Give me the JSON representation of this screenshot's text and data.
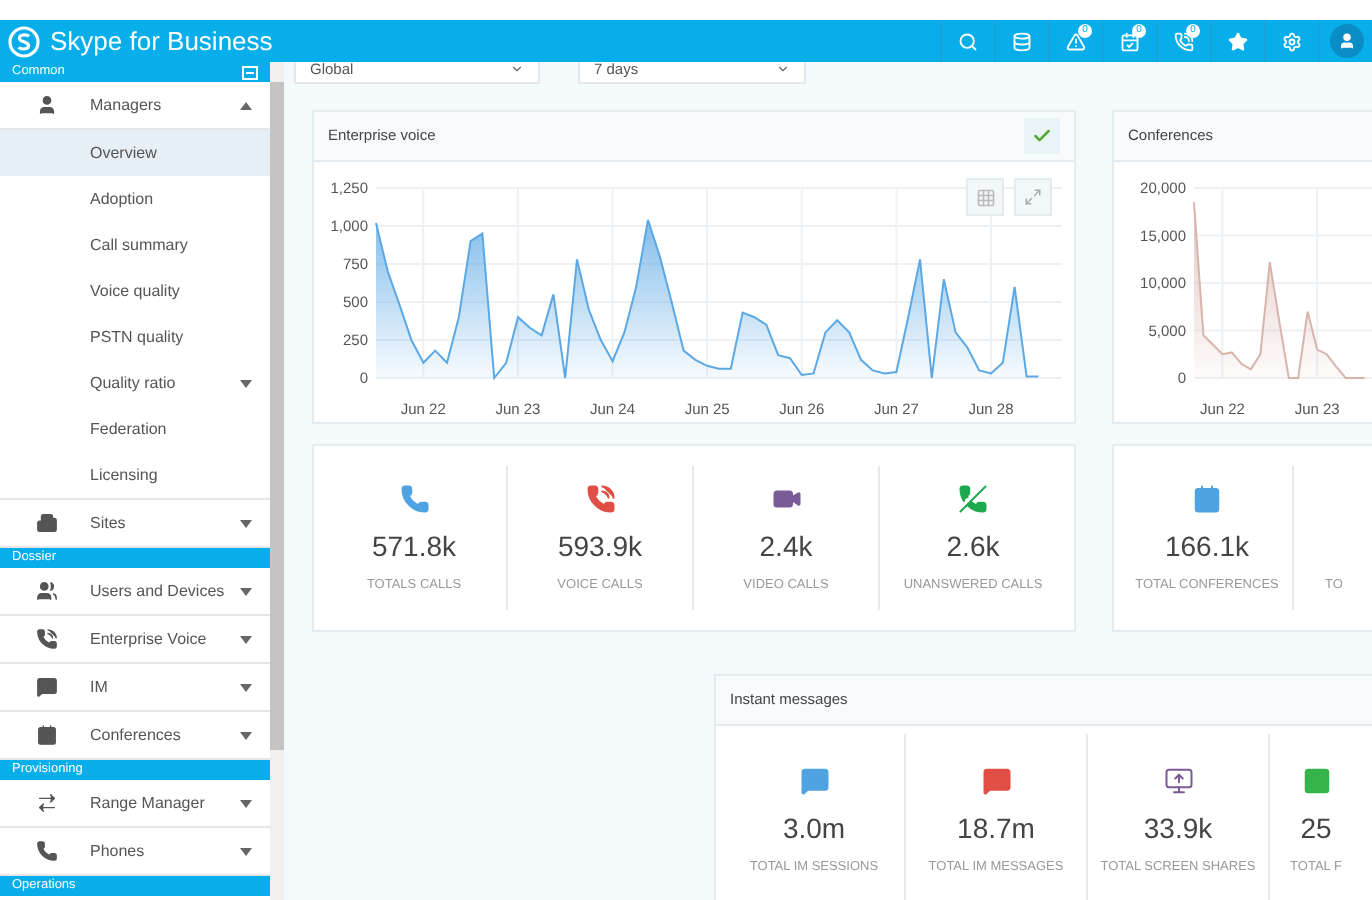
{
  "app": {
    "title": "Skype for Business"
  },
  "toolbar": {
    "badges": [
      "0",
      "0",
      "0"
    ]
  },
  "filters": [
    {
      "value": "Global"
    },
    {
      "value": "7 days"
    }
  ],
  "sidebar": {
    "sections": [
      {
        "title": "Common",
        "items": [
          {
            "label": "Managers",
            "selected": false,
            "expanded": true,
            "children": [
              {
                "label": "Overview",
                "selected": true
              },
              {
                "label": "Adoption",
                "selected": false
              },
              {
                "label": "Call summary",
                "selected": false
              },
              {
                "label": "Voice quality",
                "selected": false
              },
              {
                "label": "PSTN quality",
                "selected": false
              },
              {
                "label": "Quality ratio",
                "selected": false,
                "expanded": false
              },
              {
                "label": "Federation",
                "selected": false
              },
              {
                "label": "Licensing",
                "selected": false
              }
            ]
          },
          {
            "label": "Sites",
            "selected": false,
            "expanded": false
          }
        ]
      },
      {
        "title": "Dossier",
        "items": [
          {
            "label": "Users and Devices",
            "selected": false,
            "expanded": false
          },
          {
            "label": "Enterprise Voice",
            "selected": false,
            "expanded": false
          },
          {
            "label": "IM",
            "selected": false,
            "expanded": false
          },
          {
            "label": "Conferences",
            "selected": false,
            "expanded": false
          }
        ]
      },
      {
        "title": "Provisioning",
        "items": [
          {
            "label": "Range Manager",
            "selected": false,
            "expanded": false
          },
          {
            "label": "Phones",
            "selected": false,
            "expanded": false
          }
        ]
      },
      {
        "title": "Operations"
      }
    ]
  },
  "enterprise_voice": {
    "title": "Enterprise voice",
    "chart_data": {
      "type": "area",
      "categories": [
        null,
        null,
        null,
        null,
        "Jun 22",
        null,
        null,
        null,
        null,
        null,
        null,
        null,
        "Jun 23",
        null,
        null,
        null,
        null,
        null,
        null,
        null,
        "Jun 24",
        null,
        null,
        null,
        null,
        null,
        null,
        null,
        "Jun 25",
        null,
        null,
        null,
        null,
        null,
        null,
        null,
        "Jun 26",
        null,
        null,
        null,
        null,
        null,
        null,
        null,
        "Jun 27",
        null,
        null,
        null,
        null,
        null,
        null,
        null,
        "Jun 28",
        null,
        null,
        null,
        null
      ],
      "grid": true,
      "series": [
        {
          "color": "#5ba8e5",
          "values": [
            1020,
            700,
            480,
            250,
            100,
            180,
            100,
            400,
            900,
            950,
            0,
            100,
            400,
            330,
            280,
            550,
            0,
            780,
            450,
            250,
            110,
            300,
            600,
            1040,
            800,
            500,
            180,
            120,
            80,
            60,
            60,
            430,
            400,
            350,
            150,
            130,
            20,
            30,
            300,
            380,
            300,
            120,
            50,
            30,
            40,
            400,
            780,
            0,
            650,
            300,
            200,
            50,
            30,
            100,
            600,
            10,
            10
          ]
        }
      ],
      "ylim": [
        0,
        1250
      ],
      "yticks": [
        {
          "value": 0,
          "label": "0"
        },
        {
          "value": 250,
          "label": "250"
        },
        {
          "value": 500,
          "label": "500"
        },
        {
          "value": 750,
          "label": "750"
        },
        {
          "value": 1000,
          "label": "1,000"
        },
        {
          "value": 1250,
          "label": "1,250"
        }
      ]
    }
  },
  "conferences": {
    "title": "Conferences",
    "chart_data": {
      "type": "area",
      "categories": [
        null,
        null,
        null,
        "Jun 22",
        null,
        null,
        null,
        null,
        null,
        null,
        null,
        null,
        null,
        "Jun 23",
        null,
        null,
        null,
        null,
        null
      ],
      "grid": true,
      "series": [
        {
          "color": "#d8b4ac",
          "values": [
            18500,
            4500,
            3500,
            2500,
            2700,
            1500,
            900,
            2500,
            12200,
            6000,
            0,
            0,
            7000,
            3000,
            2500,
            1200,
            0,
            0,
            0
          ]
        }
      ],
      "ylim": [
        0,
        20000
      ],
      "yticks": [
        {
          "value": 0,
          "label": "0"
        },
        {
          "value": 5000,
          "label": "5,000"
        },
        {
          "value": 10000,
          "label": "10,000"
        },
        {
          "value": 15000,
          "label": "15,000"
        },
        {
          "value": 20000,
          "label": "20,000"
        }
      ]
    }
  },
  "call_stats": [
    {
      "value": "571.8k",
      "label": "TOTALS CALLS",
      "color": "#4fa3e3"
    },
    {
      "value": "593.9k",
      "label": "VOICE CALLS",
      "color": "#df4f46"
    },
    {
      "value": "2.4k",
      "label": "VIDEO CALLS",
      "color": "#7b5b97"
    },
    {
      "value": "2.6k",
      "label": "UNANSWERED CALLS",
      "color": "#1ea84f"
    }
  ],
  "conference_stats": [
    {
      "value": "166.1k",
      "label": "TOTAL CONFERENCES",
      "color": "#4fa3e3"
    },
    {
      "label": "TO"
    }
  ],
  "instant_messages": {
    "title": "Instant messages",
    "stats": [
      {
        "value": "3.0m",
        "label": "TOTAL IM SESSIONS",
        "color": "#4fa3e3"
      },
      {
        "value": "18.7m",
        "label": "TOTAL IM MESSAGES",
        "color": "#df4f46"
      },
      {
        "value": "33.9k",
        "label": "TOTAL SCREEN SHARES",
        "color": "#7b5b97"
      },
      {
        "value": "25",
        "label": "TOTAL F",
        "color": "#36b34a"
      }
    ]
  }
}
